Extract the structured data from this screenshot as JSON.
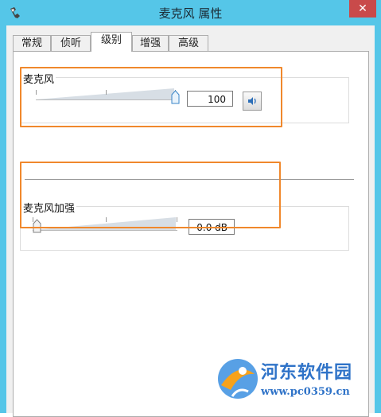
{
  "window": {
    "title": "麦克风 属性",
    "close_label": "✕"
  },
  "tabs": [
    {
      "label": "常规",
      "active": false
    },
    {
      "label": "侦听",
      "active": false
    },
    {
      "label": "级别",
      "active": true
    },
    {
      "label": "增强",
      "active": false
    },
    {
      "label": "高级",
      "active": false
    }
  ],
  "microphone": {
    "label": "麦克风",
    "value": "100",
    "level": 1.0
  },
  "boost": {
    "label": "麦克风加强",
    "value": "0.0 dB",
    "level": 0.0
  },
  "watermark": {
    "title": "河东软件园",
    "url": "www.pc0359.cn"
  },
  "colors": {
    "titlebar": "#55c6e8",
    "highlight": "#f0882c",
    "watermark": "#2f73c8"
  }
}
